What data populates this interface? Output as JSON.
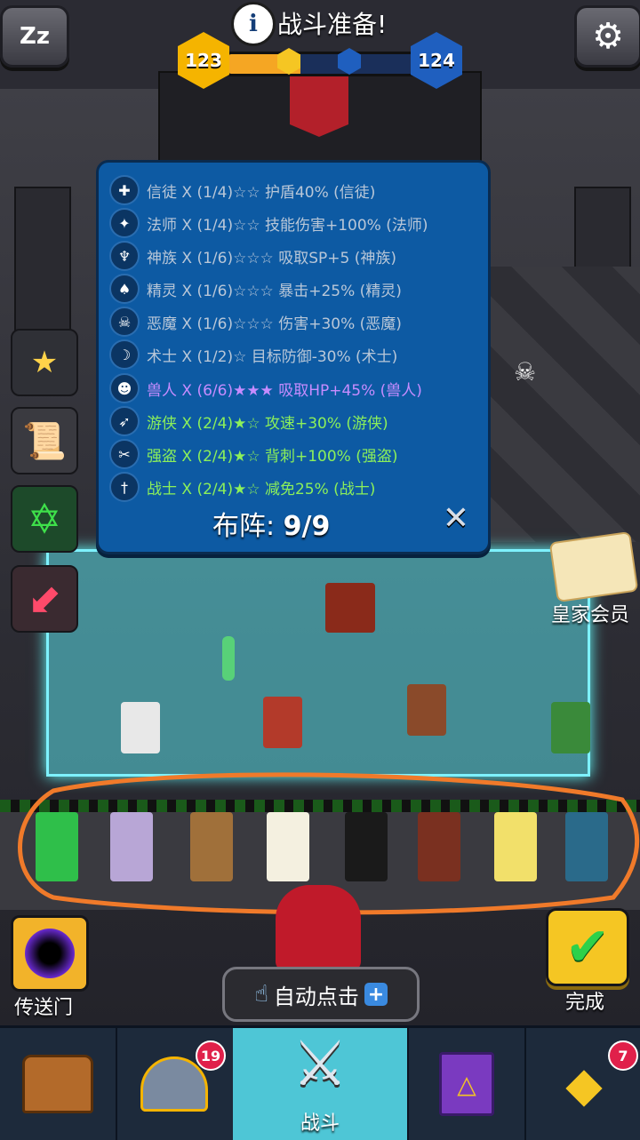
{
  "header": {
    "title": "战斗准备!",
    "info_icon": "i",
    "level_left": "123",
    "level_right": "124"
  },
  "synergy_panel": {
    "rows": [
      {
        "icon": "hammer-icon",
        "text": "信徒 X (1/4)☆☆ 护盾40% (信徒)",
        "style": "grey"
      },
      {
        "icon": "wand-icon",
        "text": "法师 X (1/4)☆☆ 技能伤害+100% (法师)",
        "style": "grey"
      },
      {
        "icon": "wings-icon",
        "text": "神族 X (1/6)☆☆☆ 吸取SP+5 (神族)",
        "style": "grey"
      },
      {
        "icon": "elf-icon",
        "text": "精灵 X (1/6)☆☆☆ 暴击+25% (精灵)",
        "style": "grey"
      },
      {
        "icon": "demon-skull-icon",
        "text": "恶魔 X (1/6)☆☆☆ 伤害+30% (恶魔)",
        "style": "grey"
      },
      {
        "icon": "warlock-icon",
        "text": "术士 X (1/2)☆ 目标防御-30% (术士)",
        "style": "grey"
      },
      {
        "icon": "orc-icon",
        "text": "兽人 X (6/6)★★★ 吸取HP+45% (兽人)",
        "style": "purple"
      },
      {
        "icon": "bow-icon",
        "text": "游侠 X (2/4)★☆ 攻速+30% (游侠)",
        "style": "green"
      },
      {
        "icon": "daggers-icon",
        "text": "强盗 X (2/4)★☆ 背刺+100% (强盗)",
        "style": "green"
      },
      {
        "icon": "sword-icon",
        "text": "战士 X (2/4)★☆ 减免25% (战士)",
        "style": "green"
      }
    ],
    "lineup_label": "布阵:",
    "lineup_value": "9/9",
    "close_symbol": "✕"
  },
  "royal_member_label": "皇家会员",
  "portal_label": "传送门",
  "auto_click_label": "自动点击",
  "auto_click_plus": "+",
  "done_label": "完成",
  "nav": {
    "items": [
      {
        "name": "chest",
        "label": "",
        "badge": ""
      },
      {
        "name": "heroes",
        "label": "",
        "badge": "19"
      },
      {
        "name": "battle",
        "label": "战斗",
        "badge": ""
      },
      {
        "name": "book",
        "label": "",
        "badge": ""
      },
      {
        "name": "amulet",
        "label": "",
        "badge": "7"
      }
    ]
  },
  "colors": {
    "panel_bg": "#0d5aa3",
    "orc_purple": "#c68cff",
    "active_green": "#8cf05a",
    "board_cyan": "#7ef2ff",
    "badge_red": "#e0204a"
  }
}
